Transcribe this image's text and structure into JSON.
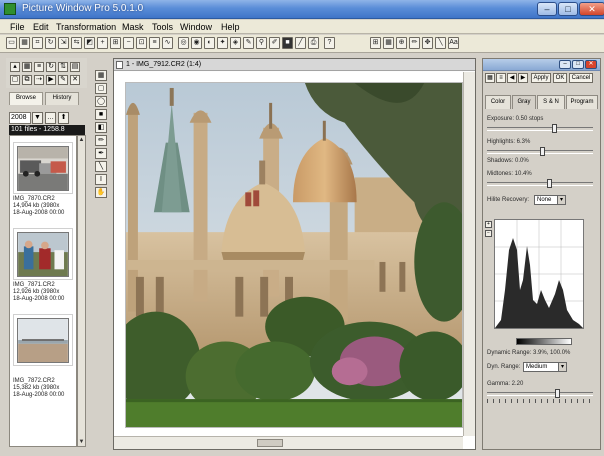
{
  "app": {
    "title": "Picture Window Pro 5.0.1.0"
  },
  "window_controls": {
    "minimize": "–",
    "maximize": "□",
    "close": "✕"
  },
  "menu": [
    "File",
    "Edit",
    "Transformation",
    "Mask",
    "Tools",
    "Window",
    "Help"
  ],
  "image_window": {
    "title": "1 - IMG_7912.CR2 (1:4)"
  },
  "browser": {
    "tabs": [
      "Browse",
      "History"
    ],
    "folder": "2008",
    "count_text": "101 files - 1258.8",
    "files": [
      {
        "name": "IMG_7870.CR2",
        "size": "14,904 kb (3980x",
        "date": "18-Aug-2008 00:00"
      },
      {
        "name": "IMG_7871.CR2",
        "size": "12,926 kb (3980x",
        "date": "18-Aug-2008 00:00"
      },
      {
        "name": "IMG_7872.CR2",
        "size": "15,382 kb (3980x",
        "date": "18-Aug-2008 00:00"
      }
    ]
  },
  "panel": {
    "buttons": {
      "apply": "Apply",
      "ok": "OK",
      "cancel": "Cancel"
    },
    "tabs": [
      "Color",
      "Gray",
      "S & N",
      "Program"
    ],
    "exposure": "Exposure: 0.50 stops",
    "highlights": "Highlights: 6.3%",
    "shadows": "Shadows: 0.0%",
    "midtones": "Midtones: 10.4%",
    "highlight_recovery": {
      "label": "Hilite Recovery:",
      "value": "None"
    },
    "dynamic_range": "Dynamic Range: 3.9%, 100.0%",
    "dyn_range_select": {
      "label": "Dyn. Range:",
      "value": "Medium"
    },
    "gamma": "Gamma: 2.20"
  },
  "colors": {
    "title_blue": "#3f74c8",
    "sky": "#c9d6df",
    "lawn": "#4f7d2c"
  }
}
